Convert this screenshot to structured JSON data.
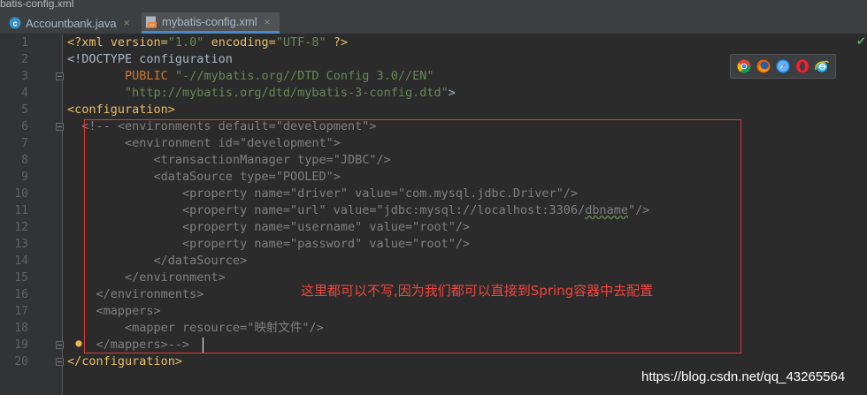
{
  "window": {
    "title_fragment": "ybatis-config.xml"
  },
  "tabs": [
    {
      "label": "Accountbank.java",
      "close": "×",
      "icon": "java-class-icon"
    },
    {
      "label": "mybatis-config.xml",
      "close": "×",
      "icon": "xml-file-icon"
    }
  ],
  "line_numbers": [
    "1",
    "2",
    "3",
    "4",
    "5",
    "6",
    "7",
    "8",
    "9",
    "10",
    "11",
    "12",
    "13",
    "14",
    "15",
    "16",
    "17",
    "18",
    "19",
    "20"
  ],
  "code": {
    "l1": {
      "a": "<?xml version=",
      "b": "\"1.0\"",
      "c": " encoding=",
      "d": "\"UTF-8\"",
      "e": " ?>"
    },
    "l2": {
      "a": "<!DOCTYPE configuration"
    },
    "l3": {
      "indent": "        ",
      "a": "PUBLIC ",
      "b": "\"-//mybatis.org//DTD Config 3.0//EN\""
    },
    "l4": {
      "indent": "        ",
      "a": "\"http://mybatis.org/dtd/mybatis-3-config.dtd\"",
      "b": ">"
    },
    "l5": {
      "a": "<configuration>"
    },
    "l6": {
      "a": "  <!-- <environments default=\"development\">"
    },
    "l7": {
      "a": "        <environment id=\"development\">"
    },
    "l8": {
      "a": "            <transactionManager type=\"JDBC\"/>"
    },
    "l9": {
      "a": "            <dataSource type=\"POOLED\">"
    },
    "l10": {
      "a": "                <property name=\"driver\" value=\"com.mysql.jdbc.Driver\"/>"
    },
    "l11": {
      "a": "                <property name=\"url\" value=\"jdbc:mysql://localhost:3306/",
      "b": "dbname",
      "c": "\"/>"
    },
    "l12": {
      "a": "                <property name=\"username\" value=\"root\"/>"
    },
    "l13": {
      "a": "                <property name=\"password\" value=\"root\"/>"
    },
    "l14": {
      "a": "            </dataSource>"
    },
    "l15": {
      "a": "        </environment>"
    },
    "l16": {
      "a": "    </environments>"
    },
    "l17": {
      "a": "    <mappers>"
    },
    "l18": {
      "a": "        <mapper resource=\"映射文件\"/>"
    },
    "l19": {
      "a": "    </mappers>-->"
    },
    "l20": {
      "a": "</configuration>"
    }
  },
  "annotation": "这里都可以不写,因为我们都可以直接到Spring容器中去配置",
  "watermark": "https://blog.csdn.net/qq_43265564",
  "browser_icons": [
    "chrome-icon",
    "firefox-icon",
    "safari-icon",
    "opera-icon",
    "ie-icon"
  ],
  "colors": {
    "annotation": "#f0463e",
    "box": "#e03a3a",
    "tag": "#e8bf6a",
    "string": "#6a8759",
    "comment": "#808080"
  }
}
